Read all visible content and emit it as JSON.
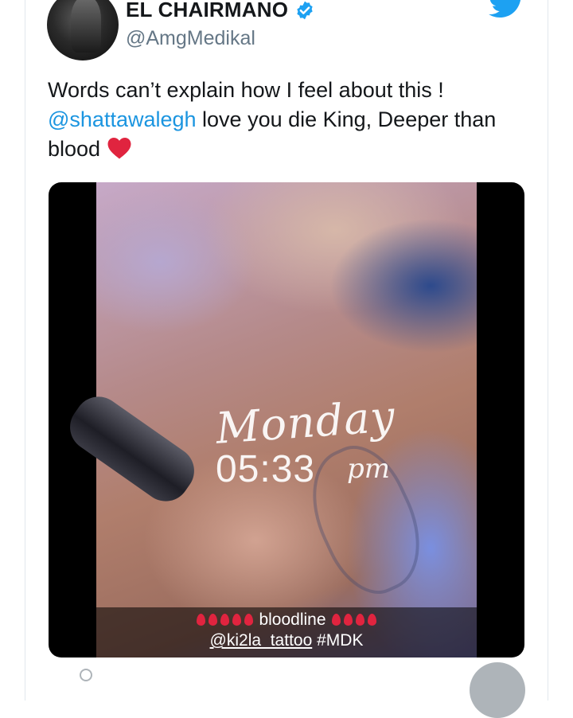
{
  "user": {
    "display_name": "EL CHAIRMANO",
    "handle": "@AmgMedikal",
    "verified": true
  },
  "tweet": {
    "text_part1": "Words can’t explain how I feel about this !",
    "mention": "@shattawalegh",
    "text_part2": " love you die King, Deeper than blood",
    "emoji": "red-heart-icon"
  },
  "media": {
    "overlay_day": "Monday",
    "overlay_time": "05:33",
    "overlay_ampm": "pm",
    "caption_word": "bloodline",
    "caption_tag_handle": "@ki2la_tattoo",
    "caption_hashtag": "#MDK"
  },
  "colors": {
    "mention": "#1b95e0",
    "verified": "#1da1f2",
    "twitter_brand": "#1da1f2",
    "drop": "#e0243f",
    "heart": "#e0243f"
  },
  "icons": [
    "verified-badge-icon",
    "twitter-bird-icon",
    "red-heart-icon",
    "blood-drop-icon"
  ]
}
